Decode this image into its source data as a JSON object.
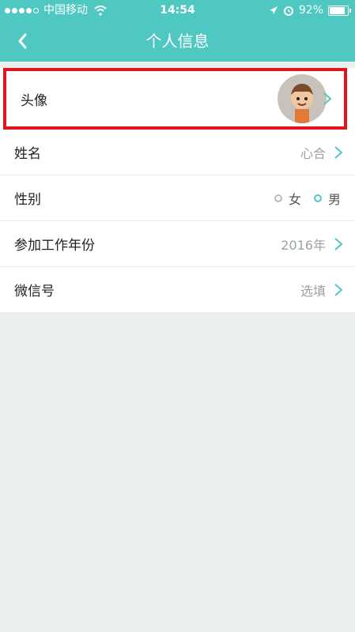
{
  "status_bar": {
    "carrier": "中国移动",
    "time": "14:54",
    "battery": "92%"
  },
  "nav": {
    "title": "个人信息"
  },
  "rows": {
    "avatar": {
      "label": "头像"
    },
    "name": {
      "label": "姓名",
      "value": "心合"
    },
    "gender": {
      "label": "性别",
      "options": [
        "女",
        "男"
      ],
      "selected": "男"
    },
    "work_year": {
      "label": "参加工作年份",
      "value": "2016年"
    },
    "wechat": {
      "label": "微信号",
      "value": "选填"
    }
  },
  "colors": {
    "accent": "#4fc8c2",
    "highlight": "#e2141d"
  }
}
